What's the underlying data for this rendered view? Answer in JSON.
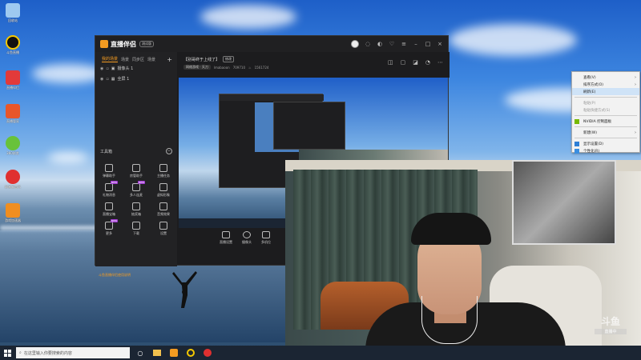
{
  "desktop": {
    "icons": [
      {
        "label": "回收站",
        "icon": "recycle-bin-icon",
        "color": "#9ec9f0"
      },
      {
        "label": "斗鱼直播",
        "icon": "app-icon",
        "color": "#f5c800"
      },
      {
        "label": "直播伴侣",
        "icon": "app-icon",
        "color": "#e23a3a"
      },
      {
        "label": "直播管家",
        "icon": "app-icon",
        "color": "#e8562a"
      },
      {
        "label": "360浏览",
        "icon": "app-icon",
        "color": "#68c23a"
      },
      {
        "label": "网易云音乐",
        "icon": "music-icon",
        "color": "#e03030"
      },
      {
        "label": "游戏加速器",
        "icon": "app-icon",
        "color": "#f08e20"
      }
    ]
  },
  "taskbar": {
    "search_placeholder": "在这里输入你要搜索的内容"
  },
  "app": {
    "brand": "直播伴侣",
    "version": "测试版",
    "scene_tabs": [
      "我的场景",
      "场景",
      "同步区",
      "场景"
    ],
    "sources": [
      "摄像头 1",
      "全屏 1"
    ],
    "toolbox_title": "工具箱",
    "tools": [
      {
        "label": "弹幕助手",
        "new": false
      },
      {
        "label": "房管助手",
        "new": false
      },
      {
        "label": "主播任务",
        "new": false
      },
      {
        "label": "礼物消息",
        "new": true
      },
      {
        "label": "多人连麦",
        "new": true
      },
      {
        "label": "虚拟形象",
        "new": false
      },
      {
        "label": "直播宝箱",
        "new": false
      },
      {
        "label": "抽奖箱",
        "new": false
      },
      {
        "label": "音频效果",
        "new": false
      },
      {
        "label": "更多",
        "new": true
      },
      {
        "label": "下载",
        "new": false
      },
      {
        "label": "设置",
        "new": false
      }
    ],
    "notice": "斗鱼直播伴侣使用说明",
    "preview": {
      "title": "【别哥终于上线了】",
      "edit_label": "修改",
      "category": "网络游戏 · 天刀",
      "user": "lmabaoon",
      "room_id": "709710",
      "fans": "1561724"
    },
    "bottom_tools": [
      "直播设置",
      "摄像头",
      "多机位"
    ]
  },
  "context_menu": {
    "items": [
      {
        "label": "查看(V)",
        "arrow": true,
        "disabled": false,
        "hover": false
      },
      {
        "label": "排序方式(O)",
        "arrow": true,
        "disabled": false,
        "hover": false
      },
      {
        "label": "刷新(E)",
        "arrow": false,
        "disabled": false,
        "hover": true
      },
      {
        "label": "粘贴(P)",
        "arrow": false,
        "disabled": true,
        "hover": false
      },
      {
        "label": "粘贴快捷方式(S)",
        "arrow": false,
        "disabled": true,
        "hover": false
      },
      {
        "label": "NVIDIA 控制面板",
        "arrow": false,
        "disabled": false,
        "hover": false
      },
      {
        "label": "新建(W)",
        "arrow": true,
        "disabled": false,
        "hover": false
      },
      {
        "label": "显示设置(D)",
        "arrow": false,
        "disabled": false,
        "hover": false
      },
      {
        "label": "个性化(R)",
        "arrow": false,
        "disabled": false,
        "hover": false
      }
    ]
  },
  "webcam": {
    "watermark": "斗鱼",
    "watermark_sub": "直播中"
  }
}
